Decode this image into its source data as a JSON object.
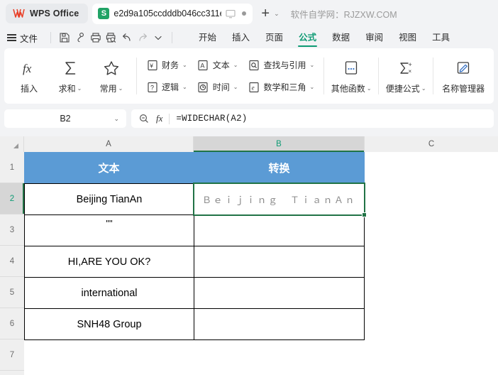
{
  "titlebar": {
    "app_name": "WPS Office",
    "app_icon": "wps-logo-icon",
    "document_tab": {
      "icon": "spreadsheet-s-icon",
      "name": "e2d9a105ccdddb046cc311e",
      "monitor_icon": "monitor-icon",
      "modified_dot": "modified-dot-icon"
    },
    "new_tab_label": "+",
    "tab_list_caret": "⌄",
    "promo_text": "软件自学网：RJZXW.COM"
  },
  "menubar": {
    "menu_icon": "hamburger-icon",
    "file_label": "文件",
    "quick_icons": [
      {
        "name": "save-icon"
      },
      {
        "name": "share-icon"
      },
      {
        "name": "print-icon"
      },
      {
        "name": "print-preview-icon"
      },
      {
        "name": "undo-icon"
      },
      {
        "name": "redo-icon"
      },
      {
        "name": "chevron-down-icon"
      }
    ],
    "tabs": [
      {
        "label": "开始",
        "active": false
      },
      {
        "label": "插入",
        "active": false
      },
      {
        "label": "页面",
        "active": false
      },
      {
        "label": "公式",
        "active": true
      },
      {
        "label": "数据",
        "active": false
      },
      {
        "label": "审阅",
        "active": false
      },
      {
        "label": "视图",
        "active": false
      },
      {
        "label": "工具",
        "active": false
      }
    ]
  },
  "ribbon": {
    "big_buttons": [
      {
        "label": "插入",
        "icon": "fx-icon",
        "caret": ""
      },
      {
        "label": "求和",
        "icon": "sigma-icon",
        "caret": "⌄"
      },
      {
        "label": "常用",
        "icon": "star-icon",
        "caret": "⌄"
      }
    ],
    "menu_columns": [
      {
        "items": [
          {
            "label": "财务",
            "icon": "currency-yen-icon",
            "caret": "⌄"
          },
          {
            "label": "逻辑",
            "icon": "question-mark-icon",
            "caret": "⌄"
          }
        ]
      },
      {
        "items": [
          {
            "label": "文本",
            "icon": "letter-a-icon",
            "caret": "⌄"
          },
          {
            "label": "时间",
            "icon": "clock-icon",
            "caret": "⌄"
          }
        ]
      },
      {
        "items": [
          {
            "label": "查找与引用",
            "icon": "magnifier-icon",
            "caret": "⌄"
          },
          {
            "label": "数学和三角",
            "icon": "letter-e-icon",
            "caret": "⌄"
          }
        ]
      }
    ],
    "right_buttons": [
      {
        "label": "其他函数",
        "icon": "more-functions-icon",
        "caret": "⌄"
      },
      {
        "label": "便捷公式",
        "icon": "sigma-plus-icon",
        "caret": "⌄"
      },
      {
        "label": "名称管理器",
        "icon": "name-manager-icon",
        "caret": ""
      }
    ]
  },
  "formulabar": {
    "name_box_value": "B2",
    "name_box_caret": "⌄",
    "zoom_icon": "magnifier-minus-icon",
    "fx_label": "fx",
    "formula": "=WIDECHAR(A2)"
  },
  "grid": {
    "selected_cell": "B2",
    "columns": [
      {
        "label": "A",
        "selected": false
      },
      {
        "label": "B",
        "selected": true
      },
      {
        "label": "C",
        "selected": false
      }
    ],
    "rows": [
      {
        "label": "1",
        "selected": false
      },
      {
        "label": "2",
        "selected": true
      },
      {
        "label": "3",
        "selected": false
      },
      {
        "label": "4",
        "selected": false
      },
      {
        "label": "5",
        "selected": false
      },
      {
        "label": "6",
        "selected": false
      },
      {
        "label": "7",
        "selected": false
      }
    ],
    "cells": {
      "A1": "文本",
      "B1": "转换",
      "A2": "Beijing TianAn",
      "B2": "Ｂｅｉｊｉｎｇ　ＴｉａｎＡｎ",
      "A3": "\"\"",
      "B3": "",
      "A4": "HI,ARE YOU OK?",
      "B4": "",
      "A5": "international",
      "B5": "",
      "A6": "SNH48 Group",
      "B6": ""
    },
    "colors": {
      "header_fill": "#5b9bd5",
      "header_text": "#ffffff",
      "selection": "#217346",
      "result_text": "#8c8c8c"
    }
  }
}
